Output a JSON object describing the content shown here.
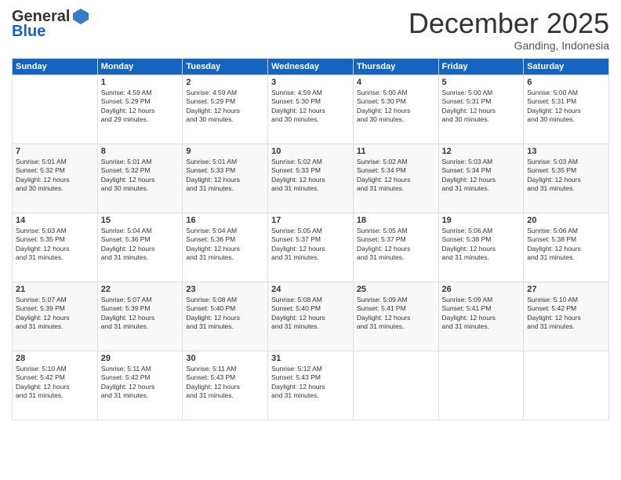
{
  "header": {
    "logo_general": "General",
    "logo_blue": "Blue",
    "month": "December 2025",
    "location": "Ganding, Indonesia"
  },
  "days_of_week": [
    "Sunday",
    "Monday",
    "Tuesday",
    "Wednesday",
    "Thursday",
    "Friday",
    "Saturday"
  ],
  "weeks": [
    [
      {
        "day": "",
        "info": ""
      },
      {
        "day": "1",
        "info": "Sunrise: 4:59 AM\nSunset: 5:29 PM\nDaylight: 12 hours\nand 29 minutes."
      },
      {
        "day": "2",
        "info": "Sunrise: 4:59 AM\nSunset: 5:29 PM\nDaylight: 12 hours\nand 30 minutes."
      },
      {
        "day": "3",
        "info": "Sunrise: 4:59 AM\nSunset: 5:30 PM\nDaylight: 12 hours\nand 30 minutes."
      },
      {
        "day": "4",
        "info": "Sunrise: 5:00 AM\nSunset: 5:30 PM\nDaylight: 12 hours\nand 30 minutes."
      },
      {
        "day": "5",
        "info": "Sunrise: 5:00 AM\nSunset: 5:31 PM\nDaylight: 12 hours\nand 30 minutes."
      },
      {
        "day": "6",
        "info": "Sunrise: 5:00 AM\nSunset: 5:31 PM\nDaylight: 12 hours\nand 30 minutes."
      }
    ],
    [
      {
        "day": "7",
        "info": "Sunrise: 5:01 AM\nSunset: 5:32 PM\nDaylight: 12 hours\nand 30 minutes."
      },
      {
        "day": "8",
        "info": "Sunrise: 5:01 AM\nSunset: 5:32 PM\nDaylight: 12 hours\nand 30 minutes."
      },
      {
        "day": "9",
        "info": "Sunrise: 5:01 AM\nSunset: 5:33 PM\nDaylight: 12 hours\nand 31 minutes."
      },
      {
        "day": "10",
        "info": "Sunrise: 5:02 AM\nSunset: 5:33 PM\nDaylight: 12 hours\nand 31 minutes."
      },
      {
        "day": "11",
        "info": "Sunrise: 5:02 AM\nSunset: 5:34 PM\nDaylight: 12 hours\nand 31 minutes."
      },
      {
        "day": "12",
        "info": "Sunrise: 5:03 AM\nSunset: 5:34 PM\nDaylight: 12 hours\nand 31 minutes."
      },
      {
        "day": "13",
        "info": "Sunrise: 5:03 AM\nSunset: 5:35 PM\nDaylight: 12 hours\nand 31 minutes."
      }
    ],
    [
      {
        "day": "14",
        "info": "Sunrise: 5:03 AM\nSunset: 5:35 PM\nDaylight: 12 hours\nand 31 minutes."
      },
      {
        "day": "15",
        "info": "Sunrise: 5:04 AM\nSunset: 5:36 PM\nDaylight: 12 hours\nand 31 minutes."
      },
      {
        "day": "16",
        "info": "Sunrise: 5:04 AM\nSunset: 5:36 PM\nDaylight: 12 hours\nand 31 minutes."
      },
      {
        "day": "17",
        "info": "Sunrise: 5:05 AM\nSunset: 5:37 PM\nDaylight: 12 hours\nand 31 minutes."
      },
      {
        "day": "18",
        "info": "Sunrise: 5:05 AM\nSunset: 5:37 PM\nDaylight: 12 hours\nand 31 minutes."
      },
      {
        "day": "19",
        "info": "Sunrise: 5:06 AM\nSunset: 5:38 PM\nDaylight: 12 hours\nand 31 minutes."
      },
      {
        "day": "20",
        "info": "Sunrise: 5:06 AM\nSunset: 5:38 PM\nDaylight: 12 hours\nand 31 minutes."
      }
    ],
    [
      {
        "day": "21",
        "info": "Sunrise: 5:07 AM\nSunset: 5:39 PM\nDaylight: 12 hours\nand 31 minutes."
      },
      {
        "day": "22",
        "info": "Sunrise: 5:07 AM\nSunset: 5:39 PM\nDaylight: 12 hours\nand 31 minutes."
      },
      {
        "day": "23",
        "info": "Sunrise: 5:08 AM\nSunset: 5:40 PM\nDaylight: 12 hours\nand 31 minutes."
      },
      {
        "day": "24",
        "info": "Sunrise: 5:08 AM\nSunset: 5:40 PM\nDaylight: 12 hours\nand 31 minutes."
      },
      {
        "day": "25",
        "info": "Sunrise: 5:09 AM\nSunset: 5:41 PM\nDaylight: 12 hours\nand 31 minutes."
      },
      {
        "day": "26",
        "info": "Sunrise: 5:09 AM\nSunset: 5:41 PM\nDaylight: 12 hours\nand 31 minutes."
      },
      {
        "day": "27",
        "info": "Sunrise: 5:10 AM\nSunset: 5:42 PM\nDaylight: 12 hours\nand 31 minutes."
      }
    ],
    [
      {
        "day": "28",
        "info": "Sunrise: 5:10 AM\nSunset: 5:42 PM\nDaylight: 12 hours\nand 31 minutes."
      },
      {
        "day": "29",
        "info": "Sunrise: 5:11 AM\nSunset: 5:42 PM\nDaylight: 12 hours\nand 31 minutes."
      },
      {
        "day": "30",
        "info": "Sunrise: 5:11 AM\nSunset: 5:43 PM\nDaylight: 12 hours\nand 31 minutes."
      },
      {
        "day": "31",
        "info": "Sunrise: 5:12 AM\nSunset: 5:43 PM\nDaylight: 12 hours\nand 31 minutes."
      },
      {
        "day": "",
        "info": ""
      },
      {
        "day": "",
        "info": ""
      },
      {
        "day": "",
        "info": ""
      }
    ]
  ]
}
